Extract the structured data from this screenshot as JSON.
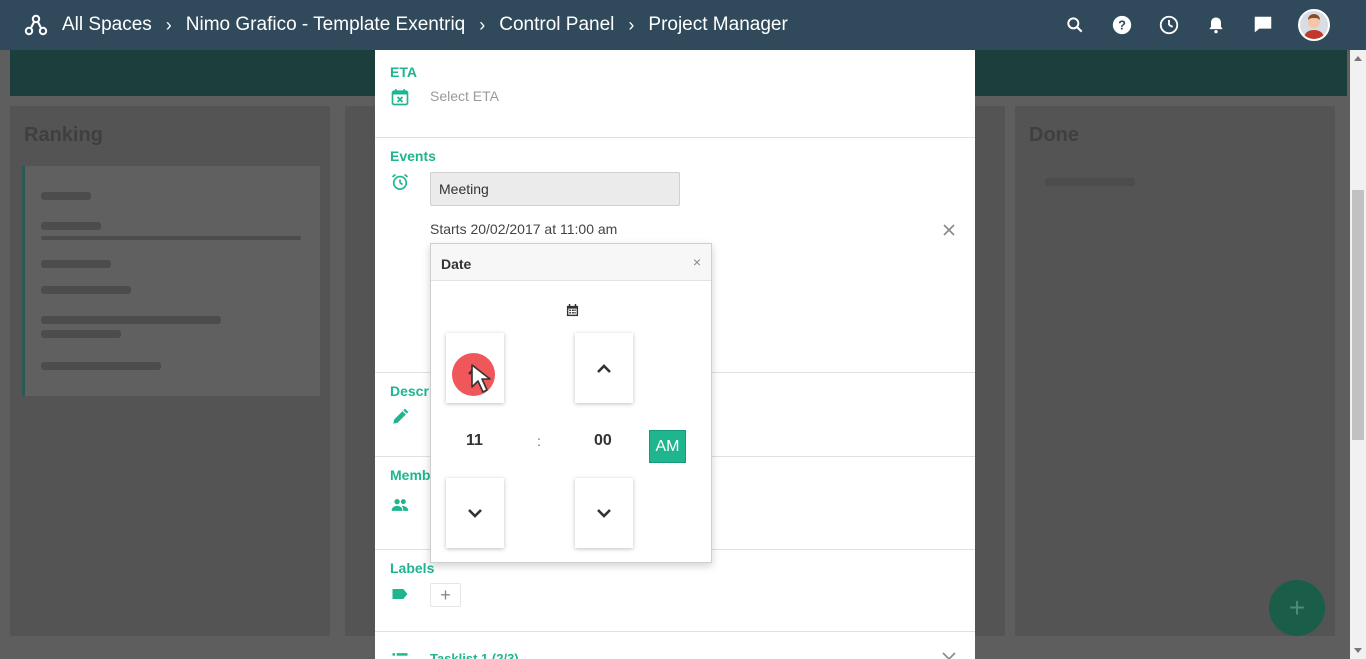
{
  "topbar": {
    "breadcrumbs": [
      "All Spaces",
      "Nimo Grafico - Template Exentriq",
      "Control Panel",
      "Project Manager"
    ],
    "icons": [
      "search-icon",
      "help-icon",
      "history-icon",
      "notifications-icon",
      "chat-icon",
      "user-avatar"
    ]
  },
  "panel": {
    "eta": {
      "title": "ETA",
      "placeholder": "Select ETA"
    },
    "events": {
      "title": "Events",
      "event_name": "Meeting",
      "starts_text": "Starts 20/02/2017 at 11:00 am"
    },
    "description": {
      "title": "Descr"
    },
    "members": {
      "title": "Memb"
    },
    "labels": {
      "title": "Labels",
      "add_label": "+"
    },
    "tasklist": {
      "title": "Tasklist 1 (2/3)"
    }
  },
  "date_popover": {
    "title": "Date",
    "close": "×",
    "hour": "11",
    "separator": ":",
    "minute": "00",
    "period": "AM"
  },
  "fab": {
    "label": "+"
  },
  "colors": {
    "accent": "#1fb58f",
    "topbar": "#304a5c",
    "cursor_highlight": "#f0575b"
  }
}
